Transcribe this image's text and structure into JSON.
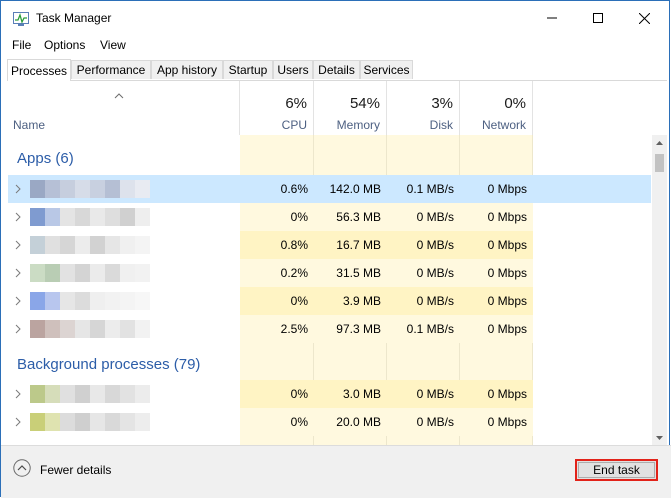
{
  "window": {
    "title": "Task Manager"
  },
  "menu": [
    "File",
    "Options",
    "View"
  ],
  "tabs": [
    "Processes",
    "Performance",
    "App history",
    "Startup",
    "Users",
    "Details",
    "Services"
  ],
  "active_tab": "Processes",
  "columns": {
    "name": {
      "label": "Name"
    },
    "cpu": {
      "percent": "6%",
      "label": "CPU"
    },
    "memory": {
      "percent": "54%",
      "label": "Memory"
    },
    "disk": {
      "percent": "3%",
      "label": "Disk"
    },
    "network": {
      "percent": "0%",
      "label": "Network"
    }
  },
  "groups": {
    "apps": {
      "title": "Apps (6)"
    },
    "background": {
      "title": "Background processes (79)"
    }
  },
  "app_rows": [
    {
      "cpu": "0.6%",
      "memory": "142.0 MB",
      "disk": "0.1 MB/s",
      "network": "0 Mbps",
      "selected": true
    },
    {
      "cpu": "0%",
      "memory": "56.3 MB",
      "disk": "0 MB/s",
      "network": "0 Mbps"
    },
    {
      "cpu": "0.8%",
      "memory": "16.7 MB",
      "disk": "0 MB/s",
      "network": "0 Mbps"
    },
    {
      "cpu": "0.2%",
      "memory": "31.5 MB",
      "disk": "0 MB/s",
      "network": "0 Mbps"
    },
    {
      "cpu": "0%",
      "memory": "3.9 MB",
      "disk": "0 MB/s",
      "network": "0 Mbps"
    },
    {
      "cpu": "2.5%",
      "memory": "97.3 MB",
      "disk": "0.1 MB/s",
      "network": "0 Mbps"
    }
  ],
  "background_rows": [
    {
      "cpu": "0%",
      "memory": "3.0 MB",
      "disk": "0 MB/s",
      "network": "0 Mbps"
    },
    {
      "cpu": "0%",
      "memory": "20.0 MB",
      "disk": "0 MB/s",
      "network": "0 Mbps"
    }
  ],
  "footer": {
    "fewer_details": "Fewer details",
    "end_task": "End task"
  },
  "colors": {
    "accent_blue": "#2c5da8",
    "selected_row": "#cce8ff",
    "column_highlight": "#fff9df",
    "end_task_outline": "#e2231a"
  },
  "icons": {
    "app": "task-manager-icon",
    "minimize": "minimize-icon",
    "maximize": "maximize-icon",
    "close": "close-icon",
    "sort": "sort-caret-icon",
    "expander": "chevron-right-icon",
    "fewer": "chevron-up-circle-icon"
  }
}
